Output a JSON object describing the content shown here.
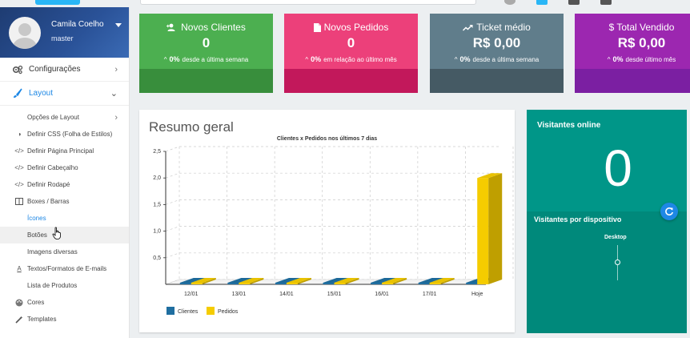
{
  "profile": {
    "name": "Camila Coelho",
    "role": "master"
  },
  "sidebar": {
    "sections": [
      {
        "label": "Configurações",
        "icon": "gears-icon"
      },
      {
        "label": "Layout",
        "icon": "brush-icon"
      }
    ],
    "layout_items": [
      {
        "label": "Opções de Layout",
        "icon": "",
        "chevron": "›"
      },
      {
        "label": "Definir CSS (Folha de Estilos)",
        "icon": "contrast-icon"
      },
      {
        "label": "Definir Página Principal",
        "icon": "code-icon"
      },
      {
        "label": "Definir Cabeçalho",
        "icon": "code-icon"
      },
      {
        "label": "Definir Rodapé",
        "icon": "code-icon"
      },
      {
        "label": "Boxes / Barras",
        "icon": "columns-icon"
      },
      {
        "label": "Ícones",
        "icon": ""
      },
      {
        "label": "Botões",
        "icon": ""
      },
      {
        "label": "Imagens diversas",
        "icon": ""
      },
      {
        "label": "Textos/Formatos de E-mails",
        "icon": "font-icon"
      },
      {
        "label": "Lista de Produtos",
        "icon": ""
      },
      {
        "label": "Cores",
        "icon": "palette-icon"
      },
      {
        "label": "Templates",
        "icon": "magic-wand-icon"
      }
    ],
    "chevron": "›",
    "chevron_down": "⌄"
  },
  "cards": [
    {
      "title": "Novos Clientes",
      "value": "0",
      "pct": "0%",
      "caption": "desde a última semana",
      "icon": "user-plus-icon",
      "color": "#4caf50"
    },
    {
      "title": "Novos Pedidos",
      "value": "0",
      "pct": "0%",
      "caption": "em relação ao último mês",
      "icon": "file-icon",
      "color": "#ec407a"
    },
    {
      "title": "Ticket médio",
      "value": "R$ 0,00",
      "pct": "0%",
      "caption": "desde a última semana",
      "icon": "trend-icon",
      "color": "#607d8b"
    },
    {
      "title": "$ Total Vendido",
      "value": "R$ 0,00",
      "pct": "0%",
      "caption": "desde último mês",
      "icon": "",
      "color": "#9c27b0"
    }
  ],
  "resumo": {
    "title": "Resumo geral"
  },
  "chart_data": {
    "type": "bar",
    "title": "Clientes x Pedidos nos últimos 7 dias",
    "categories": [
      "12/01",
      "13/01",
      "14/01",
      "15/01",
      "16/01",
      "17/01",
      "Hoje"
    ],
    "series": [
      {
        "name": "Clientes",
        "values": [
          0,
          0,
          0,
          0,
          0,
          0,
          0
        ],
        "color": "#1f6ea0"
      },
      {
        "name": "Pedidos",
        "values": [
          0,
          0,
          0,
          0,
          0,
          0,
          2
        ],
        "color": "#f5cc00"
      }
    ],
    "yticks": [
      "0,5",
      "1,0",
      "1,5",
      "2,0",
      "2,5"
    ],
    "ylim": [
      0,
      2.5
    ],
    "grid": true,
    "legend": "bottom-left",
    "three_d": true
  },
  "visitantes": {
    "online_title": "Visitantes online",
    "online_count": "0",
    "device_title": "Visitantes por dispositivo",
    "device_label": "Desktop"
  }
}
